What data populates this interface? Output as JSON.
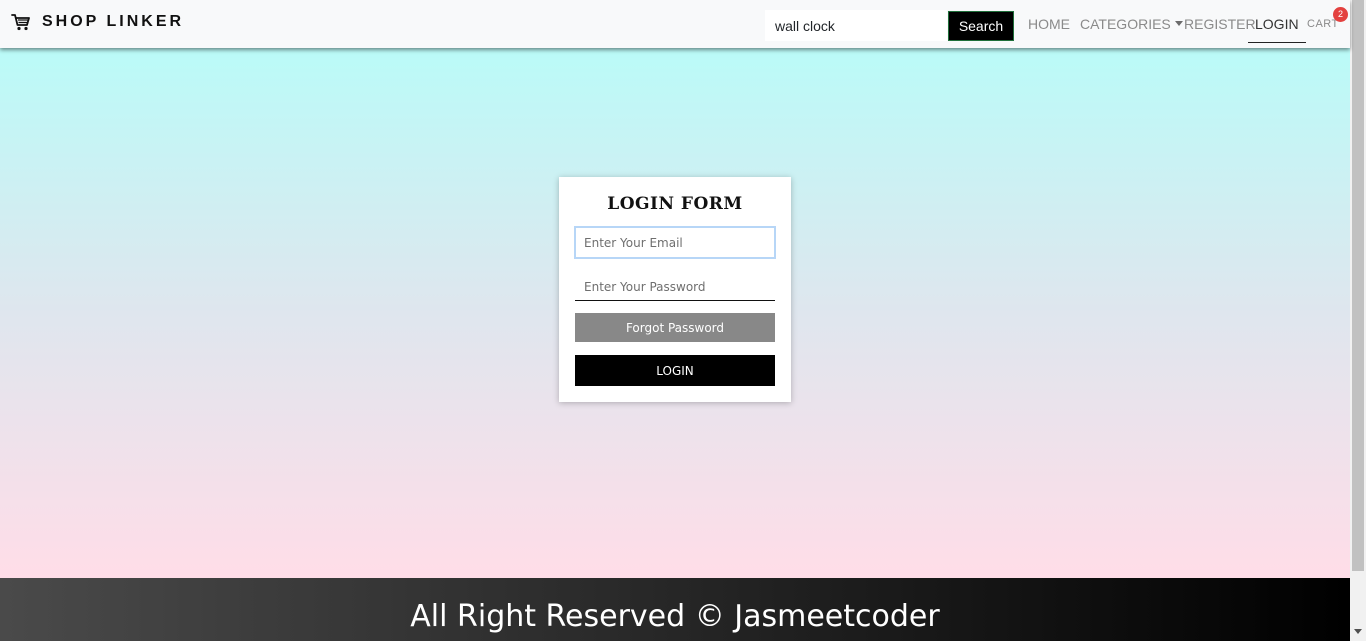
{
  "navbar": {
    "brand": {
      "icon": "shopping-cart-icon",
      "name": "SHOP LINKER"
    },
    "search": {
      "value": "wall clock",
      "button_label": "Search"
    },
    "links": {
      "home": "HOME",
      "categories": "CATEGORIES",
      "register": "REGISTER",
      "login": "LOGIN",
      "cart": "CART"
    },
    "cart_count": "2",
    "active_link": "LOGIN"
  },
  "login_form": {
    "title": "LOGIN FORM",
    "email_placeholder": "Enter Your Email",
    "password_placeholder": "Enter Your Password",
    "forgot_label": "Forgot Password",
    "login_label": "LOGIN"
  },
  "footer": {
    "text": "All Right Reserved © Jasmeetcoder"
  },
  "colors": {
    "gradient_top": "#bafbf8",
    "gradient_bottom": "#ffdde8",
    "badge": "#e3413f",
    "primary_button": "#000000",
    "secondary_button": "#888888"
  }
}
